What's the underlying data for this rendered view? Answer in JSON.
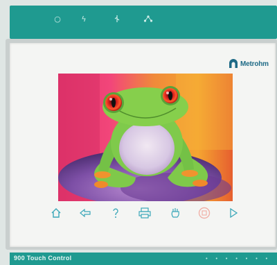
{
  "device": {
    "brand": "Metrohm",
    "model_label": "900  Touch Control"
  },
  "status_leds": [
    {
      "icon": "power-icon",
      "glyph": "○"
    },
    {
      "icon": "flash-icon",
      "glyph": "ϟ"
    },
    {
      "icon": "usb-icon",
      "glyph": "ɞ"
    },
    {
      "icon": "network-icon",
      "glyph": "♣"
    }
  ],
  "toolbar": {
    "buttons": [
      {
        "icon": "home-icon",
        "label": "home"
      },
      {
        "icon": "back-icon",
        "label": "back"
      },
      {
        "icon": "help-icon",
        "label": "help"
      },
      {
        "icon": "print-icon",
        "label": "print"
      },
      {
        "icon": "manual-icon",
        "label": "manual"
      },
      {
        "icon": "stop-icon",
        "label": "stop"
      },
      {
        "icon": "start-icon",
        "label": "start"
      }
    ]
  },
  "colors": {
    "housing": "#1f9a90",
    "icon": "#3aa7b8",
    "stop_icon": "#f0b1a8",
    "brand": "#1e6a86"
  }
}
